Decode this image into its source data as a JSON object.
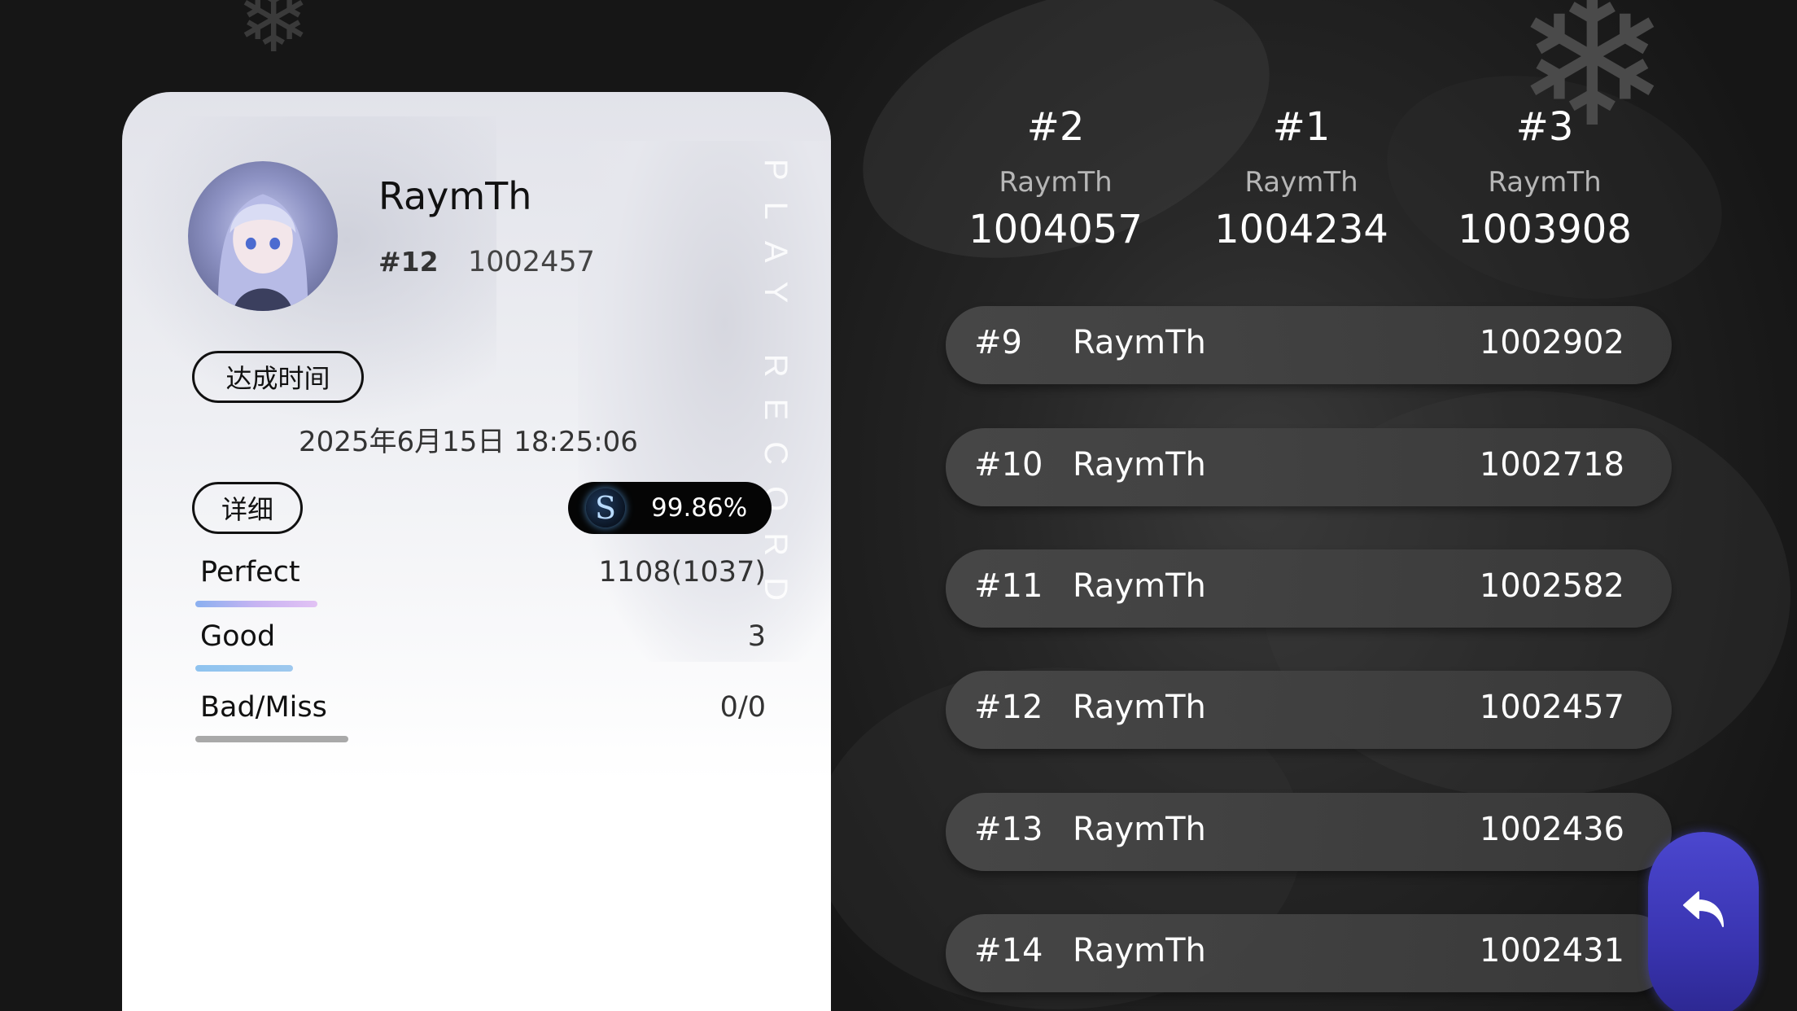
{
  "record_card": {
    "vertical_label": "PLAY RECORD",
    "player": {
      "name": "RaymTh",
      "rank": "#12",
      "score": "1002457"
    },
    "achieved_time_label": "达成时间",
    "achieved_time": "2025年6月15日 18:25:06",
    "detail_button": "详细",
    "grade": "S",
    "accuracy": "99.86%",
    "judgements": [
      {
        "label": "Perfect",
        "value": "1108(1037)"
      },
      {
        "label": "Good",
        "value": "3"
      },
      {
        "label": "Bad/Miss",
        "value": "0/0"
      }
    ]
  },
  "podium": [
    {
      "rank": "#2",
      "name": "RaymTh",
      "score": "1004057"
    },
    {
      "rank": "#1",
      "name": "RaymTh",
      "score": "1004234"
    },
    {
      "rank": "#3",
      "name": "RaymTh",
      "score": "1003908"
    }
  ],
  "leaderboard": [
    {
      "rank": "#9",
      "name": "RaymTh",
      "score": "1002902"
    },
    {
      "rank": "#10",
      "name": "RaymTh",
      "score": "1002718"
    },
    {
      "rank": "#11",
      "name": "RaymTh",
      "score": "1002582"
    },
    {
      "rank": "#12",
      "name": "RaymTh",
      "score": "1002457"
    },
    {
      "rank": "#13",
      "name": "RaymTh",
      "score": "1002436"
    },
    {
      "rank": "#14",
      "name": "RaymTh",
      "score": "1002431"
    }
  ],
  "back_button": {
    "icon": "back-arrow-icon"
  },
  "colors": {
    "background": "#141414",
    "card": "#ffffff",
    "row": "#484848",
    "back_button": "#4b47cf",
    "accuracy_pill": "#050505"
  }
}
